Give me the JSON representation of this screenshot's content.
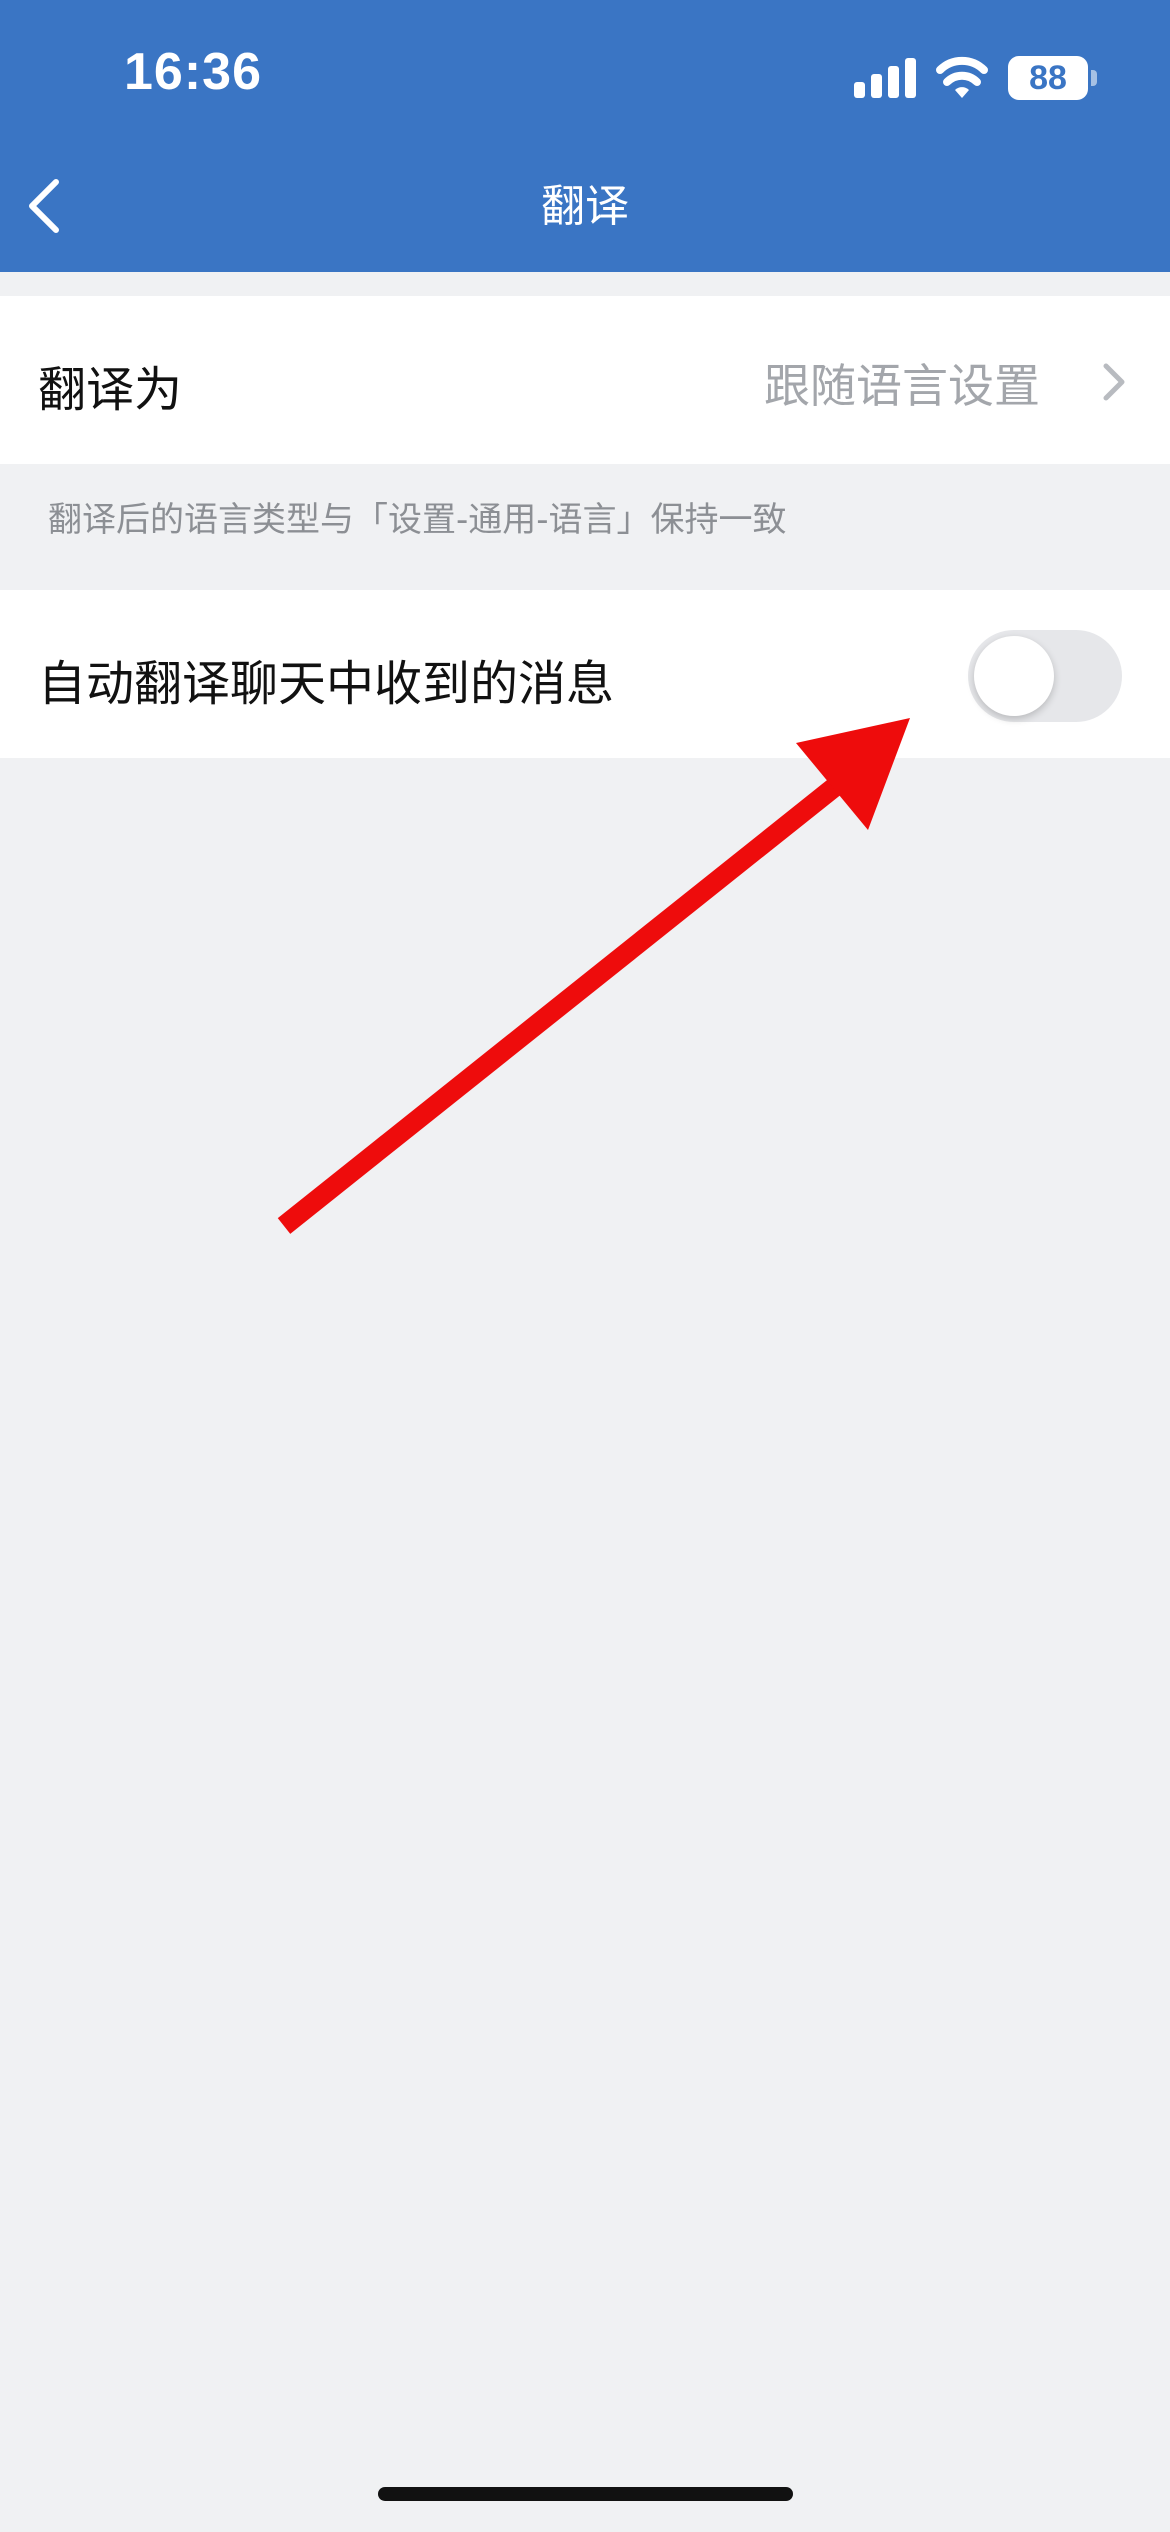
{
  "status_bar": {
    "time": "16:36",
    "battery": "88",
    "icons": [
      "signal-icon",
      "wifi-icon",
      "battery-icon"
    ]
  },
  "nav": {
    "title": "翻译",
    "back_icon": "chevron-left-icon"
  },
  "translate_to": {
    "label": "翻译为",
    "value": "跟随语言设置",
    "icon": "chevron-right-icon"
  },
  "hint": "翻译后的语言类型与「设置-通用-语言」保持一致",
  "auto_translate": {
    "label": "自动翻译聊天中收到的消息",
    "enabled": false
  },
  "annotation": {
    "type": "arrow",
    "color": "#ee0c0c",
    "target": "auto-translate-toggle"
  },
  "colors": {
    "accent": "#3a75c4",
    "background": "#f0f1f3",
    "secondary_text": "#a3a6ab"
  }
}
